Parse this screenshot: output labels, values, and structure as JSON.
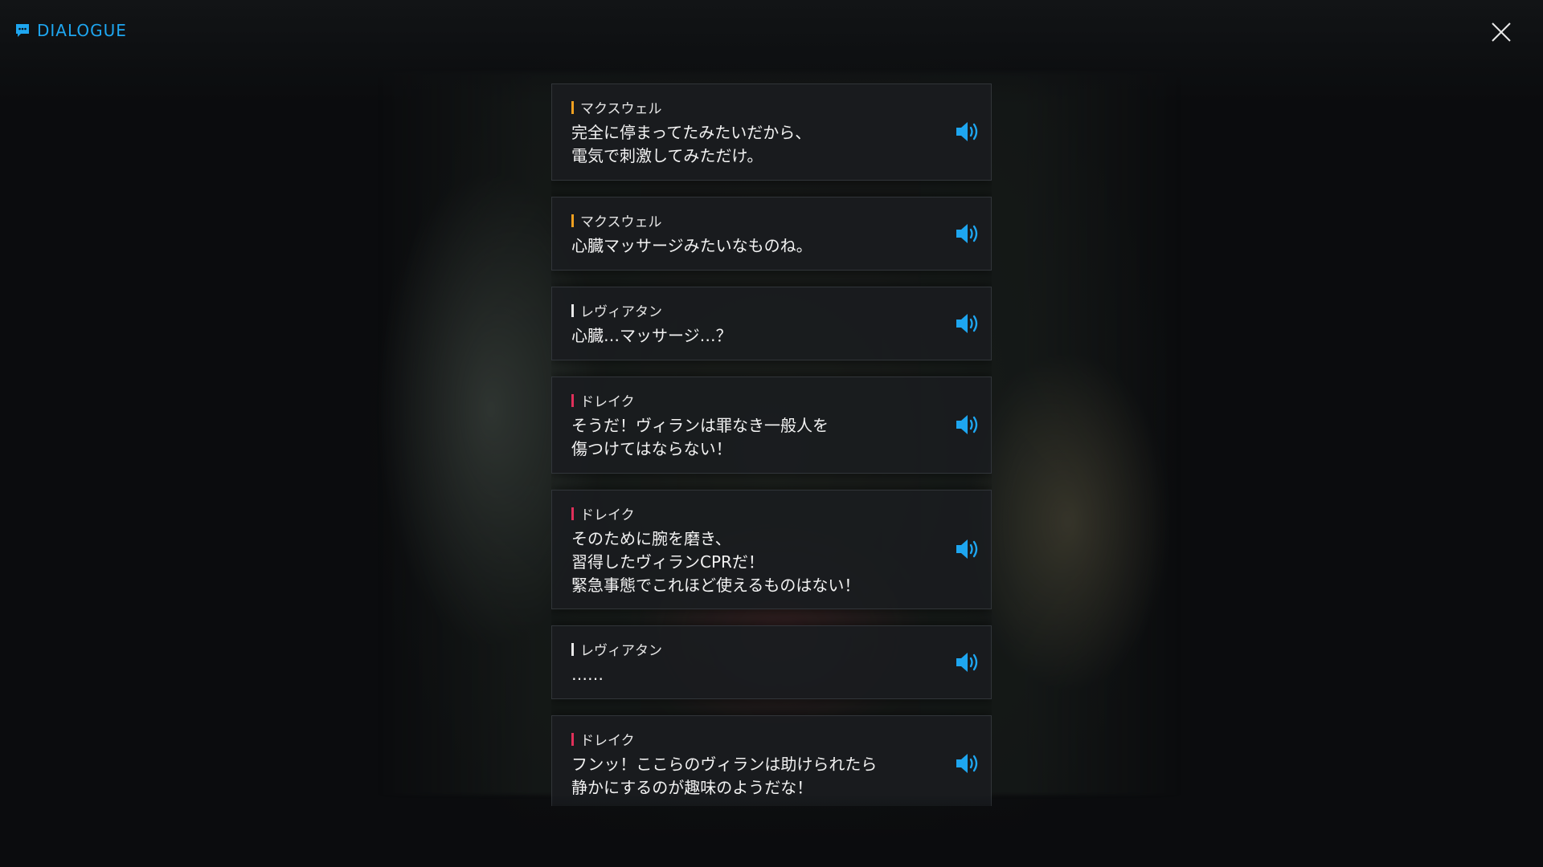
{
  "header": {
    "title": "DIALOGUE",
    "icon": "chat-bubble-icon",
    "accent_color": "#1ea6f0"
  },
  "close": {
    "icon": "close-icon"
  },
  "voice_icon": "speaker-volume-icon",
  "speaker_colors": {
    "マクスウェル": "#f0a020",
    "レヴィアタン": "#e8e8e8",
    "ドレイク": "#e0305a"
  },
  "dialogue": [
    {
      "speaker": "マクスウェル",
      "text": "完全に停まってたみたいだから、\n電気で刺激してみただけ。"
    },
    {
      "speaker": "マクスウェル",
      "text": "心臓マッサージみたいなものね。"
    },
    {
      "speaker": "レヴィアタン",
      "text": "心臓…マッサージ…？"
    },
    {
      "speaker": "ドレイク",
      "text": "そうだ！ヴィランは罪なき一般人を\n傷つけてはならない！"
    },
    {
      "speaker": "ドレイク",
      "text": "そのために腕を磨き、\n習得したヴィランCPRだ！\n緊急事態でこれほど使えるものはない！"
    },
    {
      "speaker": "レヴィアタン",
      "text": "……"
    },
    {
      "speaker": "ドレイク",
      "text": "フンッ！ここらのヴィランは助けられたら\n静かにするのが趣味のようだな！"
    }
  ]
}
